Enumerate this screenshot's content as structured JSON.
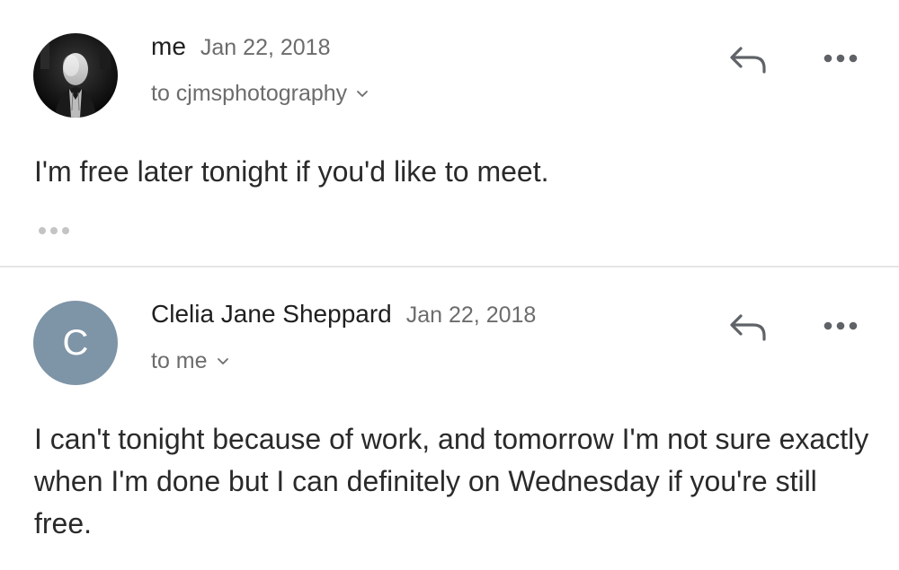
{
  "messages": [
    {
      "sender": "me",
      "date": "Jan 22, 2018",
      "recipients_label": "to cjmsphotography",
      "avatar": {
        "type": "photo",
        "icon": "profile-photo"
      },
      "body": "I'm free later tonight if you'd like to meet.",
      "has_trimmed_content": true
    },
    {
      "sender": "Clelia Jane Sheppard",
      "date": "Jan 22, 2018",
      "recipients_label": "to me",
      "avatar": {
        "type": "letter",
        "letter": "C",
        "color": "#7e94a7"
      },
      "body": "I can't tonight because of work, and tomorrow I'm not sure exactly when I'm done but I can definitely on Wednesday if you're still free."
    }
  ],
  "icons": {
    "reply": "reply-arrow-icon",
    "more": "more-horizontal-icon",
    "expand": "chevron-down-icon",
    "trimmed": "ellipsis-icon"
  },
  "colors": {
    "text_primary": "#222222",
    "text_secondary": "#6c6c6c",
    "divider": "#e6e6e6",
    "icon": "#5f6368"
  }
}
